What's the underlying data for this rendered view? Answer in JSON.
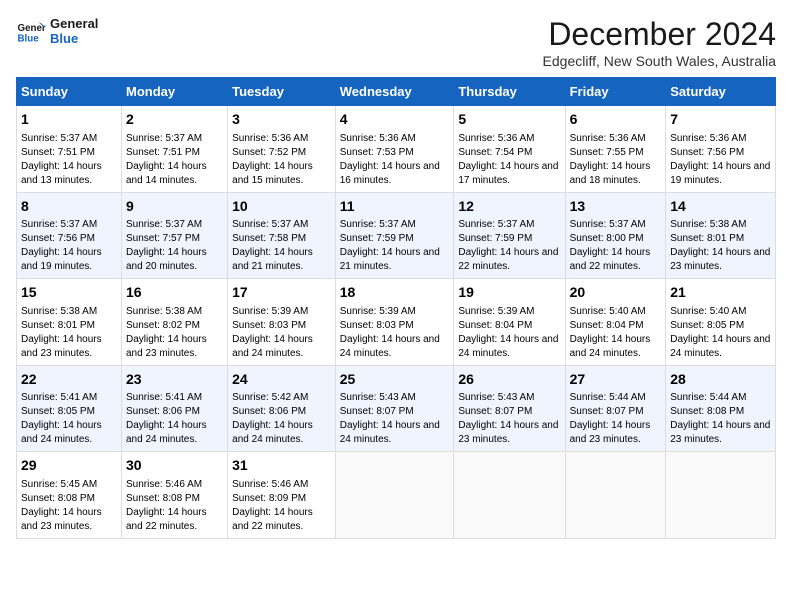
{
  "logo": {
    "line1": "General",
    "line2": "Blue"
  },
  "title": "December 2024",
  "subtitle": "Edgecliff, New South Wales, Australia",
  "weekdays": [
    "Sunday",
    "Monday",
    "Tuesday",
    "Wednesday",
    "Thursday",
    "Friday",
    "Saturday"
  ],
  "weeks": [
    [
      {
        "day": "1",
        "sunrise": "5:37 AM",
        "sunset": "7:51 PM",
        "daylight": "14 hours and 13 minutes."
      },
      {
        "day": "2",
        "sunrise": "5:37 AM",
        "sunset": "7:51 PM",
        "daylight": "14 hours and 14 minutes."
      },
      {
        "day": "3",
        "sunrise": "5:36 AM",
        "sunset": "7:52 PM",
        "daylight": "14 hours and 15 minutes."
      },
      {
        "day": "4",
        "sunrise": "5:36 AM",
        "sunset": "7:53 PM",
        "daylight": "14 hours and 16 minutes."
      },
      {
        "day": "5",
        "sunrise": "5:36 AM",
        "sunset": "7:54 PM",
        "daylight": "14 hours and 17 minutes."
      },
      {
        "day": "6",
        "sunrise": "5:36 AM",
        "sunset": "7:55 PM",
        "daylight": "14 hours and 18 minutes."
      },
      {
        "day": "7",
        "sunrise": "5:36 AM",
        "sunset": "7:56 PM",
        "daylight": "14 hours and 19 minutes."
      }
    ],
    [
      {
        "day": "8",
        "sunrise": "5:37 AM",
        "sunset": "7:56 PM",
        "daylight": "14 hours and 19 minutes."
      },
      {
        "day": "9",
        "sunrise": "5:37 AM",
        "sunset": "7:57 PM",
        "daylight": "14 hours and 20 minutes."
      },
      {
        "day": "10",
        "sunrise": "5:37 AM",
        "sunset": "7:58 PM",
        "daylight": "14 hours and 21 minutes."
      },
      {
        "day": "11",
        "sunrise": "5:37 AM",
        "sunset": "7:59 PM",
        "daylight": "14 hours and 21 minutes."
      },
      {
        "day": "12",
        "sunrise": "5:37 AM",
        "sunset": "7:59 PM",
        "daylight": "14 hours and 22 minutes."
      },
      {
        "day": "13",
        "sunrise": "5:37 AM",
        "sunset": "8:00 PM",
        "daylight": "14 hours and 22 minutes."
      },
      {
        "day": "14",
        "sunrise": "5:38 AM",
        "sunset": "8:01 PM",
        "daylight": "14 hours and 23 minutes."
      }
    ],
    [
      {
        "day": "15",
        "sunrise": "5:38 AM",
        "sunset": "8:01 PM",
        "daylight": "14 hours and 23 minutes."
      },
      {
        "day": "16",
        "sunrise": "5:38 AM",
        "sunset": "8:02 PM",
        "daylight": "14 hours and 23 minutes."
      },
      {
        "day": "17",
        "sunrise": "5:39 AM",
        "sunset": "8:03 PM",
        "daylight": "14 hours and 24 minutes."
      },
      {
        "day": "18",
        "sunrise": "5:39 AM",
        "sunset": "8:03 PM",
        "daylight": "14 hours and 24 minutes."
      },
      {
        "day": "19",
        "sunrise": "5:39 AM",
        "sunset": "8:04 PM",
        "daylight": "14 hours and 24 minutes."
      },
      {
        "day": "20",
        "sunrise": "5:40 AM",
        "sunset": "8:04 PM",
        "daylight": "14 hours and 24 minutes."
      },
      {
        "day": "21",
        "sunrise": "5:40 AM",
        "sunset": "8:05 PM",
        "daylight": "14 hours and 24 minutes."
      }
    ],
    [
      {
        "day": "22",
        "sunrise": "5:41 AM",
        "sunset": "8:05 PM",
        "daylight": "14 hours and 24 minutes."
      },
      {
        "day": "23",
        "sunrise": "5:41 AM",
        "sunset": "8:06 PM",
        "daylight": "14 hours and 24 minutes."
      },
      {
        "day": "24",
        "sunrise": "5:42 AM",
        "sunset": "8:06 PM",
        "daylight": "14 hours and 24 minutes."
      },
      {
        "day": "25",
        "sunrise": "5:43 AM",
        "sunset": "8:07 PM",
        "daylight": "14 hours and 24 minutes."
      },
      {
        "day": "26",
        "sunrise": "5:43 AM",
        "sunset": "8:07 PM",
        "daylight": "14 hours and 23 minutes."
      },
      {
        "day": "27",
        "sunrise": "5:44 AM",
        "sunset": "8:07 PM",
        "daylight": "14 hours and 23 minutes."
      },
      {
        "day": "28",
        "sunrise": "5:44 AM",
        "sunset": "8:08 PM",
        "daylight": "14 hours and 23 minutes."
      }
    ],
    [
      {
        "day": "29",
        "sunrise": "5:45 AM",
        "sunset": "8:08 PM",
        "daylight": "14 hours and 23 minutes."
      },
      {
        "day": "30",
        "sunrise": "5:46 AM",
        "sunset": "8:08 PM",
        "daylight": "14 hours and 22 minutes."
      },
      {
        "day": "31",
        "sunrise": "5:46 AM",
        "sunset": "8:09 PM",
        "daylight": "14 hours and 22 minutes."
      },
      null,
      null,
      null,
      null
    ]
  ]
}
